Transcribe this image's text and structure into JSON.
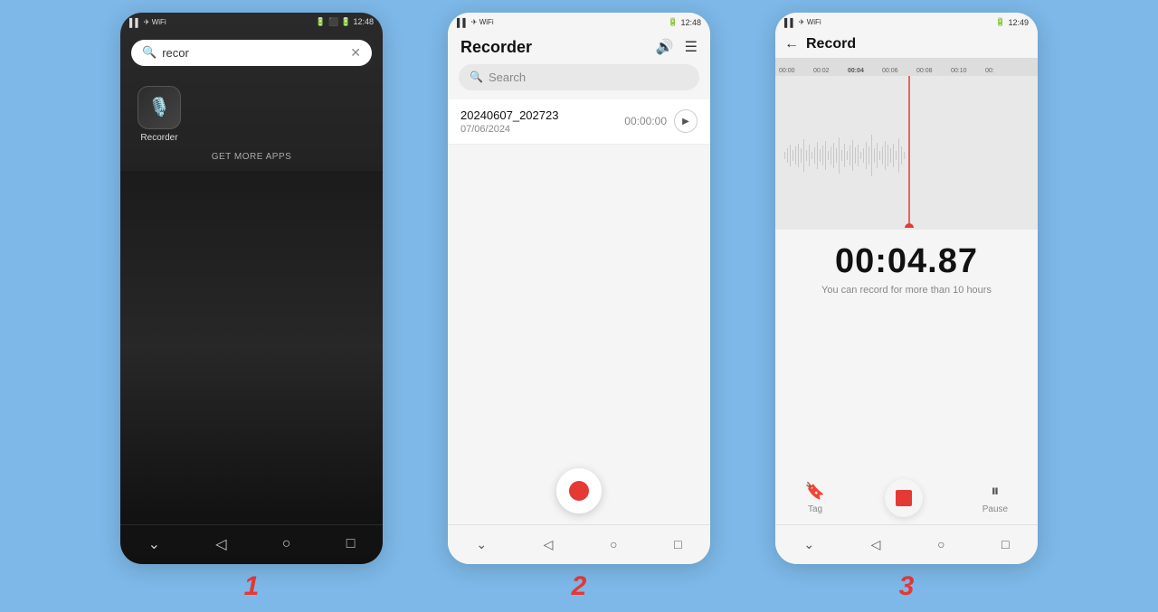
{
  "background_color": "#7db8e8",
  "screen1": {
    "status_left": "▌▌ ▌ ✈ WiFi",
    "status_right": "⬛ 🔋 12:48",
    "search_placeholder": "recor",
    "app_name": "Recorder",
    "get_more_label": "GET MORE APPS",
    "nav": [
      "⌄",
      "◁",
      "○",
      "□"
    ]
  },
  "screen2": {
    "status_left": "▌▌ ▌ ✈ WiFi",
    "status_right": "⬛ 🔋 12:48",
    "title": "Recorder",
    "search_placeholder": "Search",
    "recording_name": "20240607_202723",
    "recording_date": "07/06/2024",
    "recording_time": "00:00:00",
    "nav": [
      "⌄",
      "◁",
      "○",
      "□"
    ]
  },
  "screen3": {
    "status_left": "▌▌ ▌ ✈ WiFi",
    "status_right": "⬛ 🔋 12:49",
    "title": "Record",
    "timer": "00:04.87",
    "subtext": "You can record for more than 10 hours",
    "timeline_marks": [
      "00:00",
      "00:02",
      "00:04",
      "00:06",
      "00:08",
      "00:10",
      "00:"
    ],
    "ctrl_tag_label": "Tag",
    "ctrl_pause_label": "Pause",
    "nav": [
      "⌄",
      "◁",
      "○",
      "□"
    ]
  },
  "step_numbers": [
    "1",
    "2",
    "3"
  ]
}
